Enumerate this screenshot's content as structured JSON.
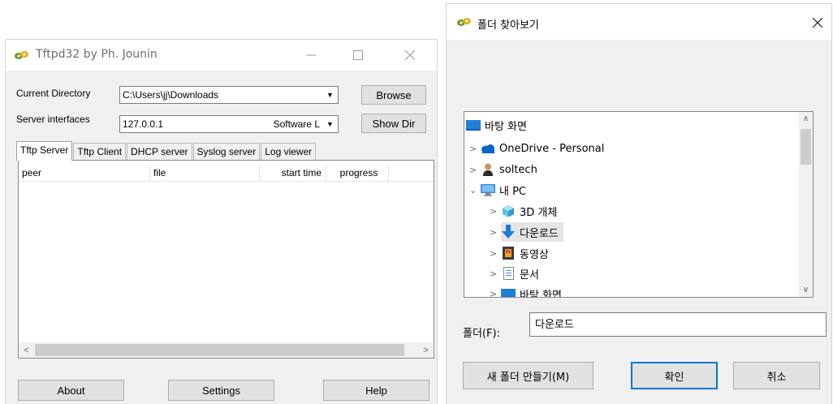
{
  "tftpd": {
    "title": "Tftpd32 by Ph. Jounin",
    "current_directory_label": "Current Directory",
    "current_directory_value": "C:\\Users\\jj\\Downloads",
    "browse_label": "Browse",
    "server_interfaces_label": "Server interfaces",
    "server_interfaces_value": "127.0.0.1",
    "server_interfaces_extra": "Software L",
    "show_dir_label": "Show Dir",
    "tabs": [
      "Tftp Server",
      "Tftp Client",
      "DHCP server",
      "Syslog server",
      "Log viewer"
    ],
    "columns": [
      "peer",
      "file",
      "start time",
      "progress"
    ],
    "about_label": "About",
    "settings_label": "Settings",
    "help_label": "Help"
  },
  "dialog": {
    "title": "폴더 찾아보기",
    "tree": [
      {
        "label": "바탕 화면",
        "icon": "desktop-icon"
      },
      {
        "label": "OneDrive - Personal",
        "icon": "cloud-icon"
      },
      {
        "label": "soltech",
        "icon": "user-icon"
      },
      {
        "label": "내 PC",
        "icon": "pc-icon"
      },
      {
        "label": "3D 개체",
        "icon": "cube-icon"
      },
      {
        "label": "다운로드",
        "icon": "download-arrow-icon"
      },
      {
        "label": "동영상",
        "icon": "film-icon"
      },
      {
        "label": "문서",
        "icon": "document-icon"
      },
      {
        "label": "바탕 화면",
        "icon": "desktop-icon"
      }
    ],
    "folder_label": "폴더(F):",
    "folder_value": "다운로드",
    "new_folder_label": "새 폴더 만들기(M)",
    "ok_label": "확인",
    "cancel_label": "취소"
  },
  "colors": {
    "selection": "#e5e5e5",
    "focus_border": "#0078d7",
    "window_bg": "#f0f0f0"
  }
}
